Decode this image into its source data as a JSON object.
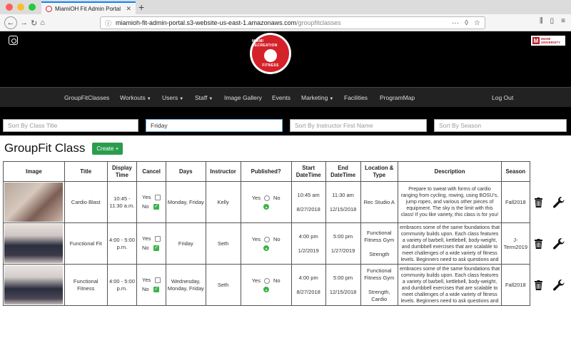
{
  "browser": {
    "tab_title": "MiamiOH Fit Admin Portal",
    "url_host": "miamioh-fit-admin-portal.s3-website-us-east-1.amazonaws.com",
    "url_path": "/groupfitclasses"
  },
  "header": {
    "logo_top": "MIAMI RECREATION",
    "logo_bottom": "FITNESS",
    "university_mark": "M",
    "university_name_1": "MIAMI",
    "university_name_2": "UNIVERSITY"
  },
  "menu": {
    "items": [
      "GroupFitClasses",
      "Workouts",
      "Users",
      "Staff",
      "Image Gallery",
      "Events",
      "Marketing",
      "Facilities",
      "ProgramMap"
    ],
    "logout": "Log Out"
  },
  "filters": [
    {
      "placeholder": "Sort By Class Title",
      "value": ""
    },
    {
      "placeholder": "",
      "value": "Friday"
    },
    {
      "placeholder": "Sort By Instructor First Name",
      "value": ""
    },
    {
      "placeholder": "Sort By Season",
      "value": ""
    }
  ],
  "page": {
    "title": "GroupFit Class",
    "create_label": "Create +"
  },
  "table": {
    "headers": [
      "Image",
      "Title",
      "Display Time",
      "Cancel",
      "Days",
      "Instructor",
      "Published?",
      "Start DateTime",
      "End DateTime",
      "Location & Type",
      "Description",
      "Season"
    ],
    "yes_label": "Yes",
    "no_label": "No",
    "rows": [
      {
        "title": "Cardio Blast",
        "display_time": "10:45 - 11:30 a.m.",
        "days": "Monday, Friday",
        "instructor": "Kelly",
        "start_time": "10:45 am",
        "start_date": "8/27/2018",
        "end_time": "11:30 am",
        "end_date": "12/15/2018",
        "location": "Rec Studio A",
        "type": "",
        "description": "Prepare to sweat with forms of cardio ranging from cycling, rowing, using BOSU's, jump ropes, and various other pieces of equipment. The sky is the limit with this class! If you like variety, this class is for you!",
        "season": "Fall2018"
      },
      {
        "title": "Functional Fit",
        "display_time": "4:00 - 5:00 p.m.",
        "days": "Friday",
        "instructor": "Seth",
        "start_time": "4:00 pm",
        "start_date": "1/2/2019",
        "end_time": "5:00 pm",
        "end_date": "1/27/2019",
        "location": "Functional Fitness Gym",
        "type": "Strength",
        "description": "Follows a similar format to CrossFit & embraces some of the same foundations that community builds upon. Each class features a variety of barbell, kettlebell, body-weight, and dumbbell exercises that are scalable to meet challenges of a wide variety of fitness levels. Beginners need to ask questions and focus on technique starting out.",
        "season": "J-Term2019"
      },
      {
        "title": "Functional Fitness",
        "display_time": "4:00 - 5:00 p.m.",
        "days": "Wednesday, Monday, Friday",
        "instructor": "Seth",
        "start_time": "4:00 pm",
        "start_date": "8/27/2018",
        "end_time": "5:00 pm",
        "end_date": "12/15/2018",
        "location": "Functional Fitness Gym",
        "type": "Strength, Cardio",
        "description": "Follows a similar format to CrossFit & embraces some of the same foundations that community builds upon. Each class features a variety of barbell, kettlebell, body-weight, and dumbbell exercises that are scalable to meet challenges of a wide variety of fitness levels. Beginners need to ask questions and focus on technique starting out.",
        "season": "Fall2018"
      }
    ]
  },
  "colors": {
    "accent_green": "#2a9d4c",
    "brand_red": "#d4222b",
    "header_bg": "#000000",
    "menu_bg": "#222222"
  }
}
